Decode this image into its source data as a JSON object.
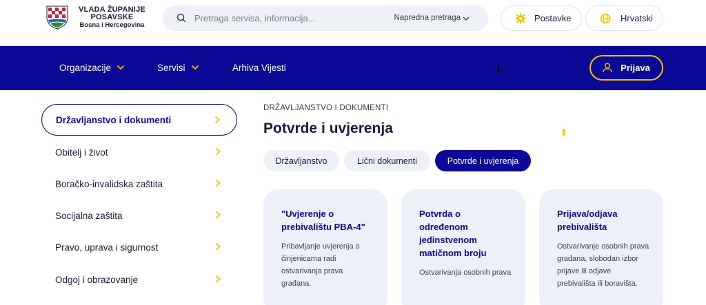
{
  "header": {
    "logo": {
      "line1": "VLADA ŽUPANIJE",
      "line2": "POSAVSKE",
      "line3": "Bosna i Hercegovina"
    },
    "search": {
      "placeholder": "Pretraga servisa, informacija...",
      "advanced_label": "Napredna pretraga"
    },
    "settings_label": "Postavke",
    "language_label": "Hrvatski"
  },
  "nav": {
    "items": [
      {
        "label": "Organizacije",
        "has_dropdown": true
      },
      {
        "label": "Servisi",
        "has_dropdown": true
      },
      {
        "label": "Arhiva Vijesti",
        "has_dropdown": false
      }
    ],
    "login_label": "Prijava"
  },
  "sidebar": {
    "items": [
      {
        "label": "Državljanstvo i dokumenti",
        "active": true
      },
      {
        "label": "Obitelj i život",
        "active": false
      },
      {
        "label": "Boračko-invalidska zaštita",
        "active": false
      },
      {
        "label": "Socijalna zaštita",
        "active": false
      },
      {
        "label": "Pravo, uprava i sigurnost",
        "active": false
      },
      {
        "label": "Odgoj i obrazovanje",
        "active": false
      }
    ]
  },
  "main": {
    "breadcrumb": "DRŽAVLJANSTVO I DOKUMENTI",
    "title": "Potvrde i uvjerenja",
    "tabs": [
      {
        "label": "Državljanstvo",
        "active": false
      },
      {
        "label": "Lični dokumenti",
        "active": false
      },
      {
        "label": "Potvrde i uvjerenja",
        "active": true
      }
    ],
    "cards": [
      {
        "title": "\"Uvjerenje o prebivalištu PBA-4\"",
        "desc": "Pribavljanje uvjerenja o činjenicama radi ostvarivanja prava građana."
      },
      {
        "title": "Potvrda o određenom jedinstvenom matičnom broju",
        "desc": "Ostvarivanja osobnih prava"
      },
      {
        "title": "Prijava/odjava prebivališta",
        "desc": "Ostvarivanje osobnih prava građana, slobodan izbor prijave ili odjave prebivališta ili boravišta."
      }
    ]
  },
  "colors": {
    "brand_navy": "#0a0a96",
    "accent_yellow": "#f2c300",
    "card_bg": "#eef0f9"
  },
  "icons": [
    "crest-logo",
    "search-icon",
    "chevron-down-icon",
    "gear-icon",
    "globe-icon",
    "user-icon",
    "chevron-right-icon"
  ]
}
